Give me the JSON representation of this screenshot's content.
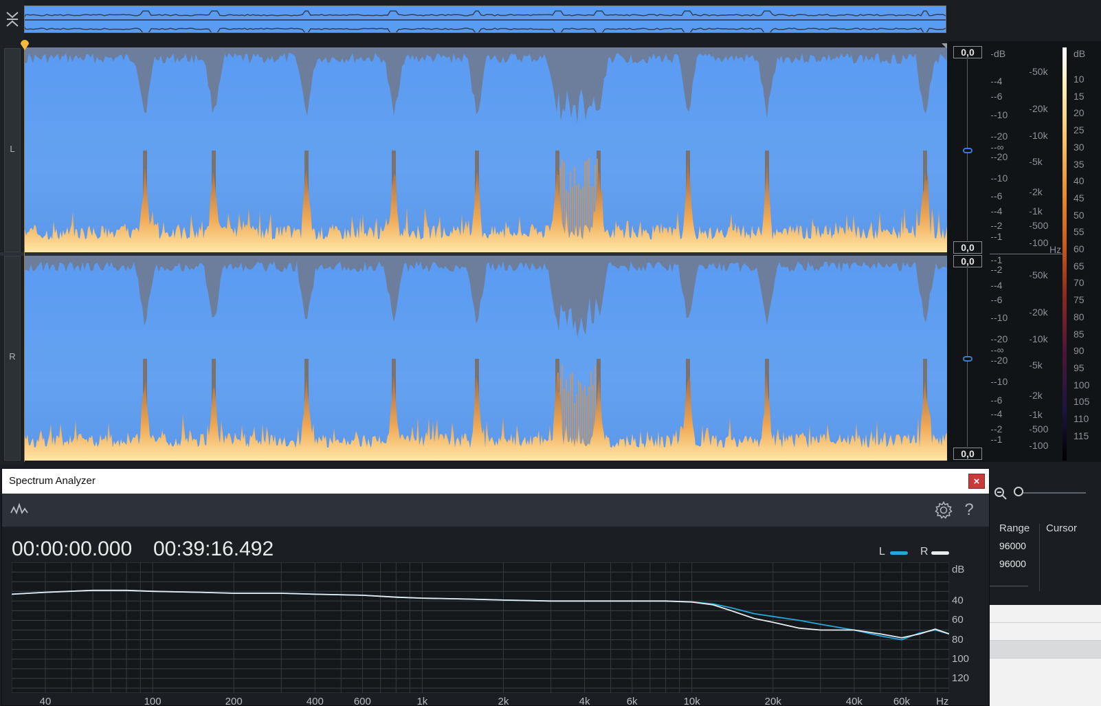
{
  "editor": {
    "channels": [
      {
        "label": "L",
        "peak_top": "0,0",
        "peak_bottom": "0,0"
      },
      {
        "label": "R",
        "peak_top": "0,0",
        "peak_bottom": "0,0"
      }
    ],
    "db_scale_L": [
      "dB",
      "-4",
      "-6",
      "-10",
      "-20",
      "-∞",
      "-20",
      "-10",
      "-6",
      "-4",
      "-2",
      "-1"
    ],
    "db_scale_R": [
      "-1",
      "-2",
      "-4",
      "-6",
      "-10",
      "-20",
      "-∞",
      "-20",
      "-10",
      "-6",
      "-4",
      "-2",
      "-1"
    ],
    "hz_scale_L": [
      "50k",
      "20k",
      "10k",
      "5k",
      "2k",
      "1k",
      "500",
      "100"
    ],
    "hz_scale_R": [
      "50k",
      "20k",
      "10k",
      "5k",
      "2k",
      "1k",
      "500",
      "100"
    ],
    "hz_unit": "Hz",
    "color_scale": [
      "dB",
      "10",
      "15",
      "20",
      "25",
      "30",
      "35",
      "40",
      "45",
      "50",
      "55",
      "60",
      "65",
      "70",
      "75",
      "80",
      "85",
      "90",
      "95",
      "100",
      "105",
      "110",
      "115"
    ]
  },
  "side_table": {
    "headers": [
      "Range",
      "Cursor"
    ],
    "rows": [
      [
        "96000",
        ""
      ],
      [
        "96000",
        ""
      ]
    ]
  },
  "spectrum_analyzer": {
    "title": "Spectrum Analyzer",
    "close_glyph": "×",
    "help_glyph": "?",
    "time_start": "00:00:00.000",
    "time_end": "00:39:16.492",
    "legend": [
      {
        "label": "L",
        "color": "#26a9d8"
      },
      {
        "label": "R",
        "color": "#e9ecef"
      }
    ],
    "y_unit": "dB",
    "y_ticks": [
      "40",
      "60",
      "80",
      "100",
      "120"
    ],
    "x_ticks": [
      "40",
      "100",
      "200",
      "400",
      "600",
      "1k",
      "2k",
      "4k",
      "6k",
      "10k",
      "20k",
      "40k",
      "60k",
      "Hz"
    ]
  },
  "chart_data": {
    "type": "line",
    "x_scale": "log",
    "xlim": [
      30,
      90000
    ],
    "ylim_db": [
      0,
      135
    ],
    "y_note": "dB ticks increase downward",
    "series": [
      {
        "name": "L",
        "color": "#26a9d8",
        "x": [
          30,
          40,
          60,
          80,
          100,
          150,
          200,
          300,
          400,
          600,
          800,
          1000,
          1500,
          2000,
          3000,
          4000,
          6000,
          8000,
          10000,
          12000,
          14000,
          17000,
          20000,
          25000,
          30000,
          40000,
          50000,
          60000,
          70000,
          80000,
          90000
        ],
        "y": [
          33,
          31,
          29,
          29,
          30,
          31,
          32,
          32,
          33,
          34,
          36,
          37,
          38,
          39,
          40,
          40,
          40,
          40,
          41,
          43,
          47,
          53,
          56,
          60,
          64,
          70,
          76,
          80,
          73,
          70,
          74
        ]
      },
      {
        "name": "R",
        "color": "#e9ecef",
        "x": [
          30,
          40,
          60,
          80,
          100,
          150,
          200,
          300,
          400,
          600,
          800,
          1000,
          1500,
          2000,
          3000,
          4000,
          6000,
          8000,
          10000,
          12000,
          14000,
          17000,
          20000,
          25000,
          30000,
          40000,
          50000,
          60000,
          70000,
          80000,
          90000
        ],
        "y": [
          33,
          31,
          29,
          29,
          30,
          31,
          32,
          32,
          33,
          34,
          36,
          37,
          38,
          39,
          40,
          40,
          40,
          40,
          41,
          44,
          50,
          58,
          62,
          68,
          70,
          70,
          74,
          78,
          74,
          69,
          74
        ]
      }
    ]
  },
  "overview_waveform": {
    "type": "stereo-waveform"
  }
}
